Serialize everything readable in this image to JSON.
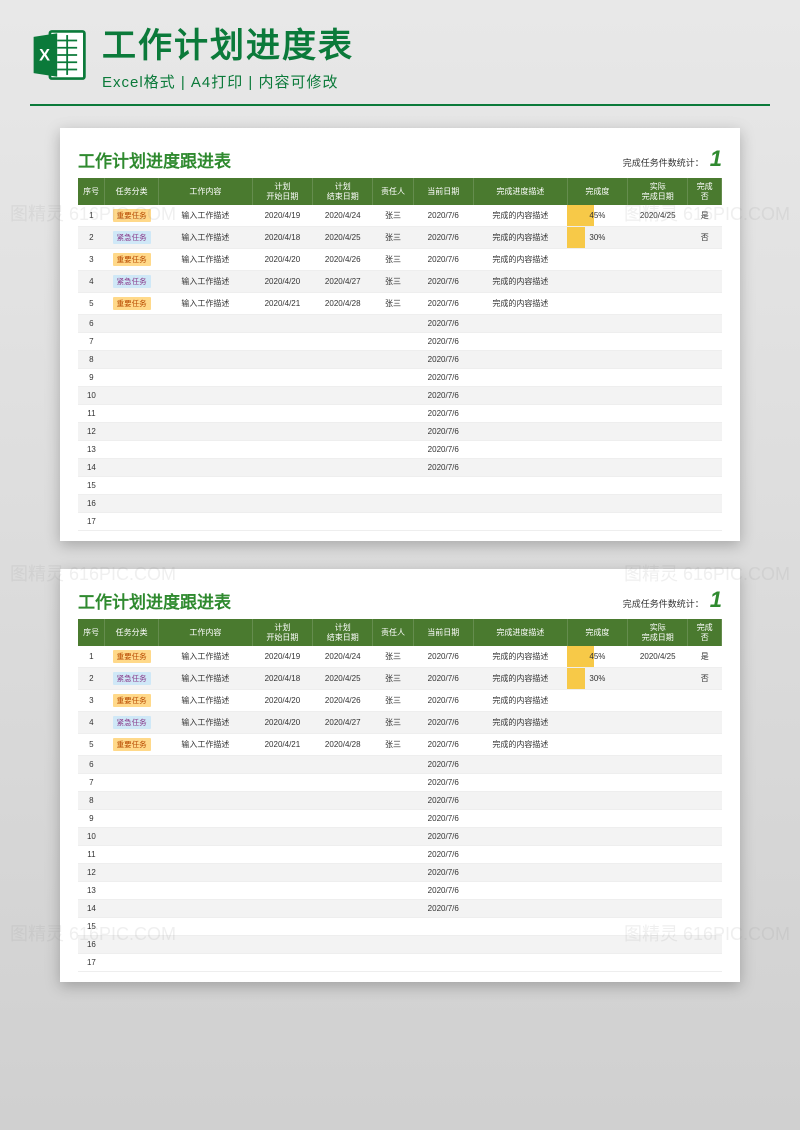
{
  "header": {
    "title": "工作计划进度表",
    "subtitle": "Excel格式 | A4打印 | 内容可修改"
  },
  "sheet": {
    "title": "工作计划进度跟进表",
    "stat_label": "完成任务件数统计：",
    "stat_value": "1",
    "columns": {
      "seq": "序号",
      "category": "任务分类",
      "content": "工作内容",
      "plan_start": "计划\n开始日期",
      "plan_end": "计划\n结束日期",
      "responsible": "责任人",
      "current_date": "当前日期",
      "progress_desc": "完成进度描述",
      "progress": "完成度",
      "actual_end": "实际\n完成日期",
      "done": "完成\n否"
    },
    "tags": {
      "important": "重要任务",
      "urgent": "紧急任务"
    },
    "rows": [
      {
        "seq": "1",
        "cat": "important",
        "content": "输入工作描述",
        "start": "2020/4/19",
        "end": "2020/4/24",
        "resp": "张三",
        "cur": "2020/7/6",
        "desc": "完成的内容描述",
        "prog": "45%",
        "prog_w": 45,
        "act": "2020/4/25",
        "done": "是"
      },
      {
        "seq": "2",
        "cat": "urgent",
        "content": "输入工作描述",
        "start": "2020/4/18",
        "end": "2020/4/25",
        "resp": "张三",
        "cur": "2020/7/6",
        "desc": "完成的内容描述",
        "prog": "30%",
        "prog_w": 30,
        "act": "",
        "done": "否"
      },
      {
        "seq": "3",
        "cat": "important",
        "content": "输入工作描述",
        "start": "2020/4/20",
        "end": "2020/4/26",
        "resp": "张三",
        "cur": "2020/7/6",
        "desc": "完成的内容描述",
        "prog": "",
        "prog_w": 0,
        "act": "",
        "done": ""
      },
      {
        "seq": "4",
        "cat": "urgent",
        "content": "输入工作描述",
        "start": "2020/4/20",
        "end": "2020/4/27",
        "resp": "张三",
        "cur": "2020/7/6",
        "desc": "完成的内容描述",
        "prog": "",
        "prog_w": 0,
        "act": "",
        "done": ""
      },
      {
        "seq": "5",
        "cat": "important",
        "content": "输入工作描述",
        "start": "2020/4/21",
        "end": "2020/4/28",
        "resp": "张三",
        "cur": "2020/7/6",
        "desc": "完成的内容描述",
        "prog": "",
        "prog_w": 0,
        "act": "",
        "done": ""
      },
      {
        "seq": "6",
        "cat": "",
        "content": "",
        "start": "",
        "end": "",
        "resp": "",
        "cur": "2020/7/6",
        "desc": "",
        "prog": "",
        "prog_w": 0,
        "act": "",
        "done": ""
      },
      {
        "seq": "7",
        "cat": "",
        "content": "",
        "start": "",
        "end": "",
        "resp": "",
        "cur": "2020/7/6",
        "desc": "",
        "prog": "",
        "prog_w": 0,
        "act": "",
        "done": ""
      },
      {
        "seq": "8",
        "cat": "",
        "content": "",
        "start": "",
        "end": "",
        "resp": "",
        "cur": "2020/7/6",
        "desc": "",
        "prog": "",
        "prog_w": 0,
        "act": "",
        "done": ""
      },
      {
        "seq": "9",
        "cat": "",
        "content": "",
        "start": "",
        "end": "",
        "resp": "",
        "cur": "2020/7/6",
        "desc": "",
        "prog": "",
        "prog_w": 0,
        "act": "",
        "done": ""
      },
      {
        "seq": "10",
        "cat": "",
        "content": "",
        "start": "",
        "end": "",
        "resp": "",
        "cur": "2020/7/6",
        "desc": "",
        "prog": "",
        "prog_w": 0,
        "act": "",
        "done": ""
      },
      {
        "seq": "11",
        "cat": "",
        "content": "",
        "start": "",
        "end": "",
        "resp": "",
        "cur": "2020/7/6",
        "desc": "",
        "prog": "",
        "prog_w": 0,
        "act": "",
        "done": ""
      },
      {
        "seq": "12",
        "cat": "",
        "content": "",
        "start": "",
        "end": "",
        "resp": "",
        "cur": "2020/7/6",
        "desc": "",
        "prog": "",
        "prog_w": 0,
        "act": "",
        "done": ""
      },
      {
        "seq": "13",
        "cat": "",
        "content": "",
        "start": "",
        "end": "",
        "resp": "",
        "cur": "2020/7/6",
        "desc": "",
        "prog": "",
        "prog_w": 0,
        "act": "",
        "done": ""
      },
      {
        "seq": "14",
        "cat": "",
        "content": "",
        "start": "",
        "end": "",
        "resp": "",
        "cur": "2020/7/6",
        "desc": "",
        "prog": "",
        "prog_w": 0,
        "act": "",
        "done": ""
      },
      {
        "seq": "15",
        "cat": "",
        "content": "",
        "start": "",
        "end": "",
        "resp": "",
        "cur": "",
        "desc": "",
        "prog": "",
        "prog_w": 0,
        "act": "",
        "done": ""
      },
      {
        "seq": "16",
        "cat": "",
        "content": "",
        "start": "",
        "end": "",
        "resp": "",
        "cur": "",
        "desc": "",
        "prog": "",
        "prog_w": 0,
        "act": "",
        "done": ""
      },
      {
        "seq": "17",
        "cat": "",
        "content": "",
        "start": "",
        "end": "",
        "resp": "",
        "cur": "",
        "desc": "",
        "prog": "",
        "prog_w": 0,
        "act": "",
        "done": ""
      }
    ]
  },
  "watermarks": [
    "图精灵 616PIC.COM"
  ]
}
